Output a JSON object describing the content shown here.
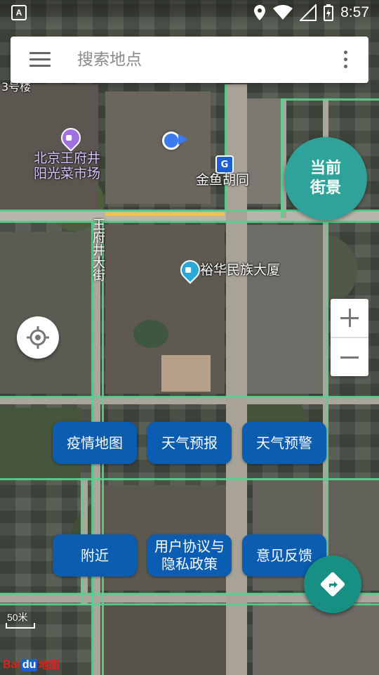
{
  "status_bar": {
    "app_icon": "A",
    "time": "8:57",
    "icons": [
      "location-icon",
      "wifi-icon",
      "signal-icon",
      "battery-icon"
    ]
  },
  "search": {
    "placeholder": "搜索地点",
    "menu_icon": "hamburger-menu-icon",
    "more_icon": "more-vertical-icon"
  },
  "map": {
    "type": "satellite",
    "pois": [
      {
        "name": "北京王府井\n阳光菜市场",
        "icon": "shopping-bag-icon",
        "color": "#a070e0"
      },
      {
        "name": "金鱼胡同",
        "icon": "metro-icon",
        "color": "#1b5fd0"
      },
      {
        "name": "裕华民族大厦",
        "icon": "building-icon",
        "color": "#2aa8d8"
      }
    ],
    "roads": [
      "王府井大街"
    ],
    "partial_labels": [
      "3号楼"
    ],
    "scale_label": "50米",
    "logo": {
      "part1": "Bai",
      "part2": "du",
      "part3": "地图"
    }
  },
  "streetview_button": {
    "line1": "当前",
    "line2": "街景",
    "color": "#2fa39a"
  },
  "zoom": {
    "in_label": "+",
    "out_label": "−"
  },
  "actions": [
    {
      "label": "疫情地图"
    },
    {
      "label": "天气预报"
    },
    {
      "label": "天气预警"
    },
    {
      "label": "附近"
    },
    {
      "label": "用户协议与\n隐私政策"
    },
    {
      "label": "意见反馈"
    }
  ],
  "colors": {
    "action_button": "#0a5db0",
    "route_fab": "#178f82",
    "location_dot": "#3a7cf0",
    "road_highlight": "#56d28e"
  }
}
